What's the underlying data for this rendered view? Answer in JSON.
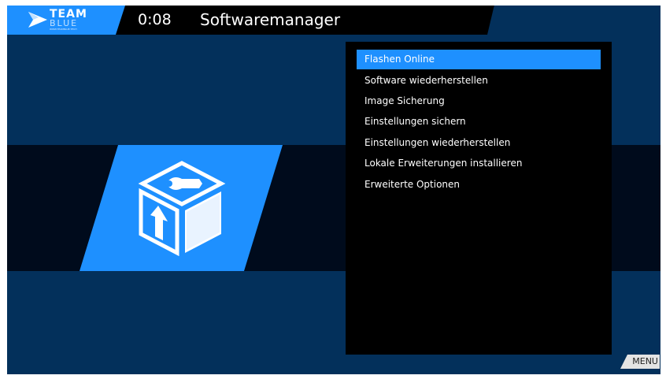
{
  "header": {
    "logo_team": "TEAM",
    "logo_blue": "BLUE",
    "logo_tagline": "WWW.TEAMBLUE.TECH",
    "clock": "0:08",
    "title": "Softwaremanager"
  },
  "icon": {
    "name": "software-package-icon"
  },
  "menu": {
    "selected_index": 0,
    "items": [
      {
        "label": "Flashen Online"
      },
      {
        "label": "Software wiederherstellen"
      },
      {
        "label": "Image Sicherung"
      },
      {
        "label": "Einstellungen sichern"
      },
      {
        "label": "Einstellungen wiederherstellen"
      },
      {
        "label": "Lokale Erweiterungen installieren"
      },
      {
        "label": "Erweiterte Optionen"
      }
    ]
  },
  "footer": {
    "menu_key": "MENU"
  },
  "colors": {
    "background": "#03305b",
    "accent": "#1e90ff",
    "band": "#000b1c",
    "menu_bg": "#000000"
  }
}
